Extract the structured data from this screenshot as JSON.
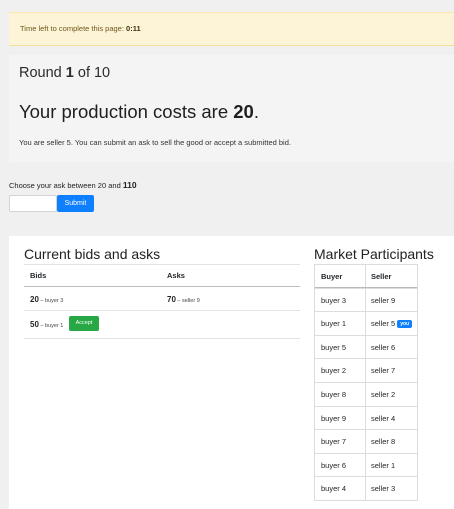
{
  "timer": {
    "label": "Time left to complete this page:",
    "value": "0:11"
  },
  "round": {
    "prefix": "Round",
    "current": "1",
    "suffix": "of 10"
  },
  "costs": {
    "prefix": "Your production costs are",
    "value": "20",
    "suffix": "."
  },
  "role_text": "You are seller 5. You can submit an ask to sell the good or accept a submitted bid.",
  "ask": {
    "prefix": "Choose your ask between 20 and",
    "max": "110",
    "input_value": "",
    "submit_label": "Submit"
  },
  "bids_panel": {
    "title": "Current bids and asks",
    "headers": [
      "Bids",
      "Asks"
    ],
    "rows": [
      {
        "bid_value": "20",
        "bid_who": " – buyer 3",
        "ask_value": "70",
        "ask_who": " – seller 9"
      },
      {
        "bid_value": "50",
        "bid_who": " – buyer 1",
        "accept_label": "Accept"
      }
    ]
  },
  "participants": {
    "title": "Market Participants",
    "headers": [
      "Buyer",
      "Seller"
    ],
    "rows": [
      [
        "buyer 3",
        "seller 9"
      ],
      [
        "buyer 1",
        "seller 5"
      ],
      [
        "buyer 5",
        "seller 6"
      ],
      [
        "buyer 2",
        "seller 7"
      ],
      [
        "buyer 8",
        "seller 2"
      ],
      [
        "buyer 9",
        "seller 4"
      ],
      [
        "buyer 7",
        "seller 8"
      ],
      [
        "buyer 6",
        "seller 1"
      ],
      [
        "buyer 4",
        "seller 3"
      ]
    ],
    "you_badge": "you"
  },
  "colors": {
    "primary": "#0d7fff",
    "success": "#28a745",
    "warning_bg": "#fdf3d6"
  }
}
